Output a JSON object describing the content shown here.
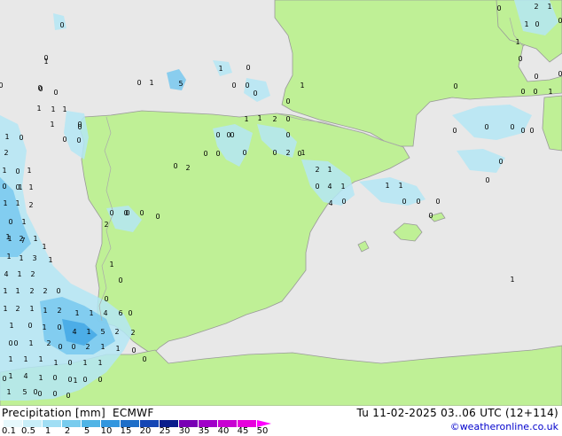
{
  "header": {
    "title": "Precipitation [mm]",
    "model": "ECMWF",
    "valid_time": "Tu 11-02-2025 03..06 UTC (12+114)",
    "credit": "©weatheronline.co.uk"
  },
  "colors": {
    "sea": "#e8e8e8",
    "land": "#bff096",
    "coast": "#999999",
    "border": "#aaaaaa",
    "precip_light": "#b4e6f5",
    "precip_mid": "#78c8ee",
    "precip_heavy": "#46aae6"
  },
  "legend": {
    "labels": [
      "0.1",
      "0.5",
      "1",
      "2",
      "5",
      "10",
      "15",
      "20",
      "25",
      "30",
      "35",
      "40",
      "45",
      "50"
    ],
    "colors": [
      "#e6f8fc",
      "#c8eef8",
      "#a0def4",
      "#78ccee",
      "#50b4e6",
      "#3296de",
      "#1e6ec8",
      "#1446b4",
      "#0a1e8c",
      "#7800b4",
      "#a000c8",
      "#c800d2",
      "#e600dc",
      "#ff00ff"
    ]
  },
  "precip_labels": [
    {
      "id": "p1",
      "v": "0"
    },
    {
      "id": "p2",
      "v": "0"
    },
    {
      "id": "p3",
      "v": "0"
    },
    {
      "id": "p4",
      "v": "1"
    },
    {
      "id": "p5",
      "v": "0"
    },
    {
      "id": "p6",
      "v": "0"
    },
    {
      "id": "p7",
      "v": "1"
    },
    {
      "id": "p8",
      "v": "5"
    },
    {
      "id": "p9",
      "v": "0"
    },
    {
      "id": "p10",
      "v": "0"
    },
    {
      "id": "p11",
      "v": "0"
    },
    {
      "id": "p12",
      "v": "0"
    },
    {
      "id": "p13",
      "v": "1"
    },
    {
      "id": "p14",
      "v": "1"
    },
    {
      "id": "p15",
      "v": "1"
    },
    {
      "id": "p16",
      "v": "1"
    },
    {
      "id": "p17",
      "v": "2"
    },
    {
      "id": "p18",
      "v": "0"
    },
    {
      "id": "p19",
      "v": "0"
    },
    {
      "id": "p20",
      "v": "0"
    },
    {
      "id": "p21",
      "v": "0"
    },
    {
      "id": "p22",
      "v": "1"
    },
    {
      "id": "p23",
      "v": "0"
    },
    {
      "id": "p24",
      "v": "0"
    },
    {
      "id": "p25",
      "v": "2"
    },
    {
      "id": "p26",
      "v": "0"
    },
    {
      "id": "p27",
      "v": "2"
    },
    {
      "id": "p28",
      "v": "1"
    },
    {
      "id": "p29",
      "v": "2"
    },
    {
      "id": "p30",
      "v": "1"
    },
    {
      "id": "p31",
      "v": "0"
    },
    {
      "id": "p32",
      "v": "4"
    },
    {
      "id": "p33",
      "v": "1"
    },
    {
      "id": "p34",
      "v": "4"
    },
    {
      "id": "p35",
      "v": "0"
    },
    {
      "id": "p36",
      "v": "1"
    },
    {
      "id": "p37",
      "v": "1"
    },
    {
      "id": "p38",
      "v": "0"
    },
    {
      "id": "p39",
      "v": "0"
    },
    {
      "id": "p40",
      "v": "0"
    },
    {
      "id": "p41",
      "v": "0"
    },
    {
      "id": "p42",
      "v": "0"
    },
    {
      "id": "p43",
      "v": "0"
    },
    {
      "id": "p44",
      "v": "0"
    },
    {
      "id": "p45",
      "v": "0"
    },
    {
      "id": "p46",
      "v": "1"
    },
    {
      "id": "p47",
      "v": "0"
    },
    {
      "id": "p48",
      "v": "0"
    },
    {
      "id": "p49",
      "v": "0"
    },
    {
      "id": "p50",
      "v": "2"
    },
    {
      "id": "p51",
      "v": "1"
    },
    {
      "id": "p52",
      "v": "1"
    },
    {
      "id": "p53",
      "v": "0"
    },
    {
      "id": "p54",
      "v": "1"
    },
    {
      "id": "p55",
      "v": "0"
    },
    {
      "id": "p56",
      "v": "0"
    },
    {
      "id": "p57",
      "v": "0"
    },
    {
      "id": "p58",
      "v": "1"
    },
    {
      "id": "p59",
      "v": "0"
    },
    {
      "id": "p60",
      "v": "0"
    },
    {
      "id": "p61",
      "v": "0"
    },
    {
      "id": "p62",
      "v": "1"
    },
    {
      "id": "p63",
      "v": "1"
    },
    {
      "id": "p64",
      "v": "2"
    },
    {
      "id": "p65",
      "v": "0"
    },
    {
      "id": "p66",
      "v": "1"
    },
    {
      "id": "p67",
      "v": "0"
    },
    {
      "id": "p68",
      "v": "0"
    },
    {
      "id": "p69",
      "v": "0"
    },
    {
      "id": "p70",
      "v": "1"
    },
    {
      "id": "p71",
      "v": "1"
    },
    {
      "id": "p72",
      "v": "1"
    },
    {
      "id": "p73",
      "v": "2"
    },
    {
      "id": "p74",
      "v": "0"
    },
    {
      "id": "p75",
      "v": "1"
    },
    {
      "id": "p76",
      "v": "1"
    },
    {
      "id": "p77",
      "v": "1"
    },
    {
      "id": "p78",
      "v": "2"
    },
    {
      "id": "p79",
      "v": "1"
    },
    {
      "id": "p80",
      "v": "1"
    },
    {
      "id": "p81",
      "v": "7"
    },
    {
      "id": "p82",
      "v": "1"
    },
    {
      "id": "p83",
      "v": "1"
    },
    {
      "id": "p84",
      "v": "3"
    },
    {
      "id": "p85",
      "v": "1"
    },
    {
      "id": "p86",
      "v": "4"
    },
    {
      "id": "p87",
      "v": "1"
    },
    {
      "id": "p88",
      "v": "2"
    },
    {
      "id": "p89",
      "v": "1"
    },
    {
      "id": "p90",
      "v": "1"
    },
    {
      "id": "p91",
      "v": "2"
    },
    {
      "id": "p92",
      "v": "2"
    },
    {
      "id": "p93",
      "v": "0"
    },
    {
      "id": "p94",
      "v": "1"
    },
    {
      "id": "p95",
      "v": "2"
    },
    {
      "id": "p96",
      "v": "1"
    },
    {
      "id": "p97",
      "v": "1"
    },
    {
      "id": "p98",
      "v": "2"
    },
    {
      "id": "p99",
      "v": "1"
    },
    {
      "id": "p100",
      "v": "1"
    },
    {
      "id": "p101",
      "v": "4"
    },
    {
      "id": "p102",
      "v": "6"
    },
    {
      "id": "p103",
      "v": "1"
    },
    {
      "id": "p104",
      "v": "0"
    },
    {
      "id": "p105",
      "v": "1"
    },
    {
      "id": "p106",
      "v": "0"
    },
    {
      "id": "p107",
      "v": "4"
    },
    {
      "id": "p108",
      "v": "1"
    },
    {
      "id": "p109",
      "v": "5"
    },
    {
      "id": "p110",
      "v": "2"
    },
    {
      "id": "p111",
      "v": "2"
    },
    {
      "id": "p112",
      "v": "0"
    },
    {
      "id": "p113",
      "v": "1"
    },
    {
      "id": "p114",
      "v": "0"
    },
    {
      "id": "p115",
      "v": "0"
    },
    {
      "id": "p116",
      "v": "2"
    },
    {
      "id": "p117",
      "v": "1"
    },
    {
      "id": "p118",
      "v": "1"
    },
    {
      "id": "p119",
      "v": "0"
    },
    {
      "id": "p120",
      "v": "1"
    },
    {
      "id": "p121",
      "v": "1"
    },
    {
      "id": "p122",
      "v": "1"
    },
    {
      "id": "p123",
      "v": "1"
    },
    {
      "id": "p124",
      "v": "0"
    },
    {
      "id": "p125",
      "v": "1"
    },
    {
      "id": "p126",
      "v": "1"
    },
    {
      "id": "p127",
      "v": "1"
    },
    {
      "id": "p128",
      "v": "4"
    },
    {
      "id": "p129",
      "v": "1"
    },
    {
      "id": "p130",
      "v": "0"
    },
    {
      "id": "p131",
      "v": "0"
    },
    {
      "id": "p132",
      "v": "0"
    },
    {
      "id": "p133",
      "v": "0"
    },
    {
      "id": "p134",
      "v": "1"
    },
    {
      "id": "p135",
      "v": "5"
    },
    {
      "id": "p136",
      "v": "0"
    },
    {
      "id": "p137",
      "v": "0"
    },
    {
      "id": "p138",
      "v": "0"
    },
    {
      "id": "p139",
      "v": "0"
    },
    {
      "id": "p140",
      "v": "0"
    },
    {
      "id": "p141",
      "v": "0"
    },
    {
      "id": "p142",
      "v": "2"
    },
    {
      "id": "p143",
      "v": "1"
    },
    {
      "id": "p144",
      "v": "0"
    },
    {
      "id": "p145",
      "v": "2"
    },
    {
      "id": "p146",
      "v": "1"
    },
    {
      "id": "p147",
      "v": "0"
    },
    {
      "id": "p148",
      "v": "0"
    },
    {
      "id": "p149",
      "v": "0"
    },
    {
      "id": "p150",
      "v": "0"
    },
    {
      "id": "p151",
      "v": "1"
    },
    {
      "id": "p152",
      "v": "1"
    },
    {
      "id": "p153",
      "v": "0"
    },
    {
      "id": "p154",
      "v": "0"
    },
    {
      "id": "p155",
      "v": "0"
    },
    {
      "id": "p156",
      "v": "1"
    },
    {
      "id": "p157",
      "v": "0"
    },
    {
      "id": "p158",
      "v": "1"
    },
    {
      "id": "p159",
      "v": "0"
    },
    {
      "id": "p160",
      "v": "0"
    },
    {
      "id": "p161",
      "v": "0"
    },
    {
      "id": "p162",
      "v": "0"
    },
    {
      "id": "p163",
      "v": "0"
    },
    {
      "id": "p164",
      "v": "0"
    },
    {
      "id": "p165",
      "v": "0"
    },
    {
      "id": "p166",
      "v": "0"
    },
    {
      "id": "p167",
      "v": "0"
    },
    {
      "id": "p168",
      "v": "0"
    },
    {
      "id": "p169",
      "v": "0"
    },
    {
      "id": "p170",
      "v": "0"
    },
    {
      "id": "p171",
      "v": "0"
    }
  ]
}
